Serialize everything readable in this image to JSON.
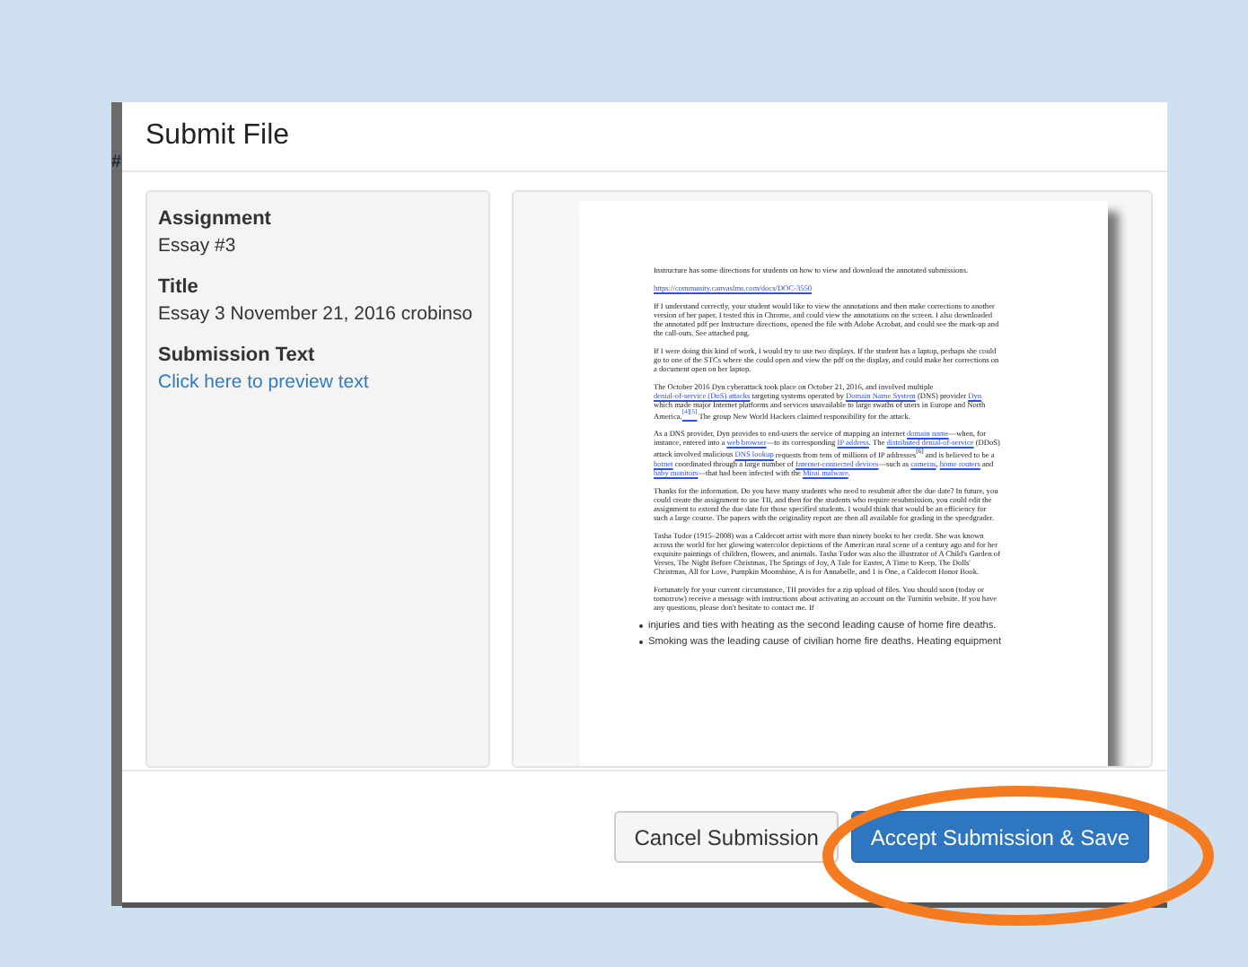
{
  "backdrop": {
    "edge_mark": "#"
  },
  "dialog": {
    "title": "Submit File",
    "details": [
      {
        "label": "Assignment",
        "value": "Essay #3",
        "link": false
      },
      {
        "label": "Title",
        "value": "Essay 3 November 21, 2016 crobinso",
        "link": false
      },
      {
        "label": "Submission Text",
        "value": "Click here to preview text",
        "link": true
      }
    ],
    "document": {
      "paragraphs": [
        [
          {
            "text": "Instructure has some directions for students on how to view and download the annotated submissions.",
            "link": false
          }
        ],
        [
          {
            "text": "https://community.canvaslms.com/docs/DOC-3550",
            "link": true
          }
        ],
        [
          {
            "text": "If I understand correctly, your student would like to view the annotations and then make corrections to another version of her paper. I tested this in Chrome, and could view the annotations on the screen. I also downloaded the annotated pdf per Instructure directions, opened the file with Adobe Acrobat, and could see the mark-up and the call-outs. See attached png.",
            "link": false
          }
        ],
        [
          {
            "text": "If I were doing this kind of work, I would try to use two displays. If the student has a laptop, perhaps she could go to one of the STCs where she could open and view the pdf on the display, and could make her corrections on a document open on her laptop.",
            "link": false
          }
        ],
        [
          {
            "text": "The October 2016 Dyn cyberattack took place on October 21, 2016, and involved multiple ",
            "link": false
          },
          {
            "text": "denial-of-service (DoS) attacks",
            "link": true
          },
          {
            "text": " targeting systems operated by ",
            "link": false
          },
          {
            "text": "Domain Name System",
            "link": true
          },
          {
            "text": " (DNS) provider ",
            "link": false
          },
          {
            "text": "Dyn",
            "link": true
          },
          {
            "text": " which made major Internet platforms and services unavailable to large swaths of users in Europe and North America.",
            "link": false
          },
          {
            "text": "$^{[4][5]}$",
            "link": true
          },
          {
            "text": " The group New World Hackers claimed responsibility for the attack.",
            "link": false
          }
        ],
        [
          {
            "text": "As a DNS provider, Dyn provides to end-users the service of mapping an internet ",
            "link": false
          },
          {
            "text": "domain name",
            "link": true
          },
          {
            "text": "—when, for instance, entered into a ",
            "link": false
          },
          {
            "text": "web browser",
            "link": true
          },
          {
            "text": "—to its corresponding ",
            "link": false
          },
          {
            "text": "IP address",
            "link": true
          },
          {
            "text": ". The ",
            "link": false
          },
          {
            "text": "distributed denial-of-service",
            "link": true
          },
          {
            "text": " (DDoS) attack involved malicious ",
            "link": false
          },
          {
            "text": "DNS lookup",
            "link": true
          },
          {
            "text": " requests from tens of millions of IP addresses$^{[6]}$ and is believed to be a ",
            "link": false
          },
          {
            "text": "botnet",
            "link": true
          },
          {
            "text": " coordinated through a large number of ",
            "link": false
          },
          {
            "text": "Internet-connected devices",
            "link": true
          },
          {
            "text": "—such as ",
            "link": false
          },
          {
            "text": "cameras",
            "link": true
          },
          {
            "text": ", ",
            "link": false
          },
          {
            "text": "home routers",
            "link": true
          },
          {
            "text": " and ",
            "link": false
          },
          {
            "text": "baby monitors",
            "link": true
          },
          {
            "text": "—that had been infected with the ",
            "link": false
          },
          {
            "text": "Mirai malware",
            "link": true
          },
          {
            "text": ".",
            "link": false
          }
        ],
        [
          {
            "text": "Thanks for the information. Do you have many students who need to resubmit after the due date? In future, you could create the assignment to use TII, and then for the students who require resubmission, you could edit the assignment to extend the due date for those specified students. I would think that would be an efficiency for such a large course. The papers with the originality report are then all available for grading in the speedgrader.",
            "link": false
          }
        ],
        [
          {
            "text": "Tasha Tudor (1915–2008) was a Caldecott artist with more than ninety books to her credit. She was known across the world for her glowing watercolor depictions of the American rural scene of a century ago and for her exquisite paintings of children, flowers, and animals. Tasha Tudor was also the illustrator of A Child's Garden of Verses, The Night Before Christmas, The Springs of Joy, A Tale for Easter, A Time to Keep, The Dolls' Christmas, All for Love, Pumpkin Moonshine, A is for Annabelle, and 1 is One, a Caldecott Honor Book.",
            "link": false
          }
        ],
        [
          {
            "text": "Fortunately for your current circumstance, TII provides for a zip upload of files. You should soon (today or tomorrow) receive a message with instructions about activating an account on the Turnitin website. If you have any questions, please don't hesitate to contact me. If",
            "link": false
          }
        ]
      ],
      "bullets": [
        "injuries and ties with heating as the second leading cause of home fire deaths.",
        "Smoking was the leading cause of civilian home fire deaths. Heating equipment"
      ]
    },
    "buttons": [
      {
        "label": "Cancel Submission",
        "kind": "secondary"
      },
      {
        "label": "Accept Submission & Save",
        "kind": "primary"
      }
    ]
  },
  "annotation": {
    "kind": "ellipse",
    "color": "#f47b20"
  }
}
